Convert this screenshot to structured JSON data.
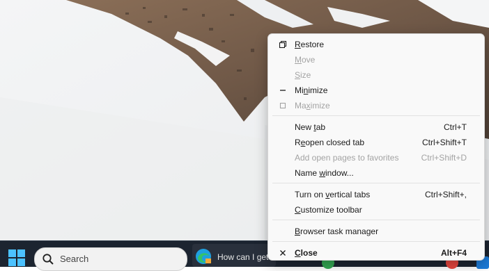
{
  "taskbar": {
    "search_label": "Search",
    "edge_window_title": "How can I get"
  },
  "menu": {
    "items": [
      {
        "pre": "",
        "u": "R",
        "post": "estore",
        "shortcut": "",
        "enabled": true,
        "glyph": "restore-icon"
      },
      {
        "pre": "",
        "u": "M",
        "post": "ove",
        "shortcut": "",
        "enabled": false,
        "glyph": ""
      },
      {
        "pre": "",
        "u": "S",
        "post": "ize",
        "shortcut": "",
        "enabled": false,
        "glyph": ""
      },
      {
        "pre": "Mi",
        "u": "n",
        "post": "imize",
        "shortcut": "",
        "enabled": true,
        "glyph": "minimize-icon"
      },
      {
        "pre": "Ma",
        "u": "x",
        "post": "imize",
        "shortcut": "",
        "enabled": false,
        "glyph": "maximize-icon"
      },
      {
        "pre": "New ",
        "u": "t",
        "post": "ab",
        "shortcut": "Ctrl+T",
        "enabled": true,
        "glyph": ""
      },
      {
        "pre": "R",
        "u": "e",
        "post": "open closed tab",
        "shortcut": "Ctrl+Shift+T",
        "enabled": true,
        "glyph": ""
      },
      {
        "pre": "Add open pages to favorites",
        "u": "",
        "post": "",
        "shortcut": "Ctrl+Shift+D",
        "enabled": false,
        "glyph": ""
      },
      {
        "pre": "Name ",
        "u": "w",
        "post": "indow...",
        "shortcut": "",
        "enabled": true,
        "glyph": ""
      },
      {
        "pre": "Turn on ",
        "u": "v",
        "post": "ertical tabs",
        "shortcut": "Ctrl+Shift+,",
        "enabled": true,
        "glyph": ""
      },
      {
        "pre": "",
        "u": "C",
        "post": "ustomize toolbar",
        "shortcut": "",
        "enabled": true,
        "glyph": ""
      },
      {
        "pre": "",
        "u": "B",
        "post": "rowser task manager",
        "shortcut": "",
        "enabled": true,
        "glyph": ""
      },
      {
        "pre": "",
        "u": "C",
        "post": "lose",
        "shortcut": "Alt+F4",
        "enabled": true,
        "glyph": "close-icon",
        "bold": true
      }
    ]
  },
  "colors": {
    "start_accent": "#4cc2ff",
    "disabled_text": "#a3a3a3",
    "menu_bg": "#f9f9f9"
  }
}
